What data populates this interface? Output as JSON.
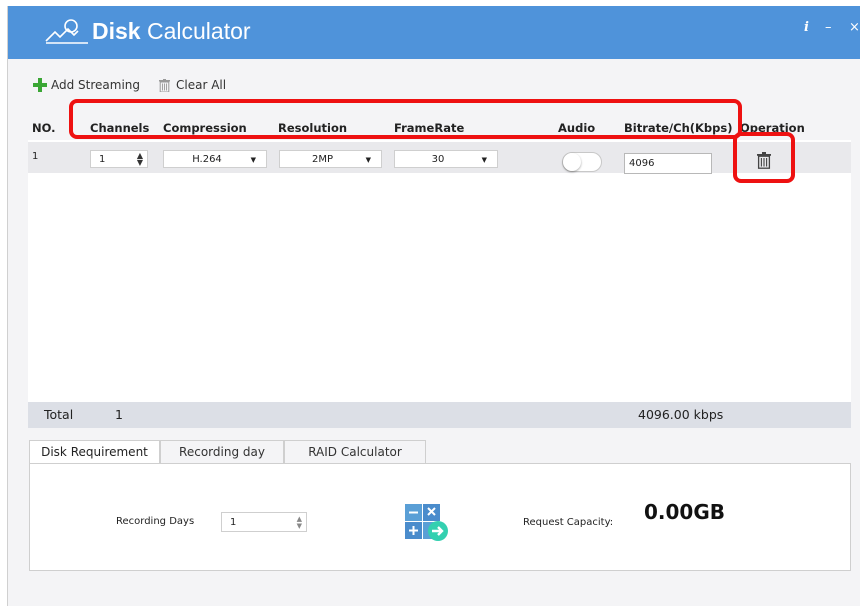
{
  "app": {
    "title_bold": "Disk",
    "title_rest": " Calculator",
    "info_icon": "info-icon",
    "minimize_label": "–",
    "close_label": "×"
  },
  "toolbar": {
    "add_streaming": "Add Streaming",
    "clear_all": "Clear All"
  },
  "table": {
    "headers": {
      "no": "NO.",
      "channels": "Channels",
      "compression": "Compression",
      "resolution": "Resolution",
      "framerate": "FrameRate",
      "audio": "Audio",
      "bitrate": "Bitrate/Ch(Kbps)",
      "operation": "Operation"
    },
    "rows": [
      {
        "no": "1",
        "channels": "1",
        "compression": "H.264",
        "resolution": "2MP",
        "framerate": "30",
        "audio": false,
        "bitrate": "4096"
      }
    ]
  },
  "total": {
    "label": "Total",
    "channels": "1",
    "bitrate": "4096.00 kbps"
  },
  "tabs": [
    {
      "label": "Disk Requirement",
      "active": true
    },
    {
      "label": "Recording day",
      "active": false
    },
    {
      "label": "RAID Calculator",
      "active": false
    }
  ],
  "disk_requirement": {
    "recording_days_label": "Recording Days",
    "recording_days_value": "1",
    "request_capacity_label": "Request Capacity:",
    "request_capacity_value": "0.00GB"
  },
  "colors": {
    "titlebar": "#4f93da",
    "highlight": "#ee1111",
    "add_icon": "#3aa635",
    "calculator_icon": "#5a9fd6"
  }
}
